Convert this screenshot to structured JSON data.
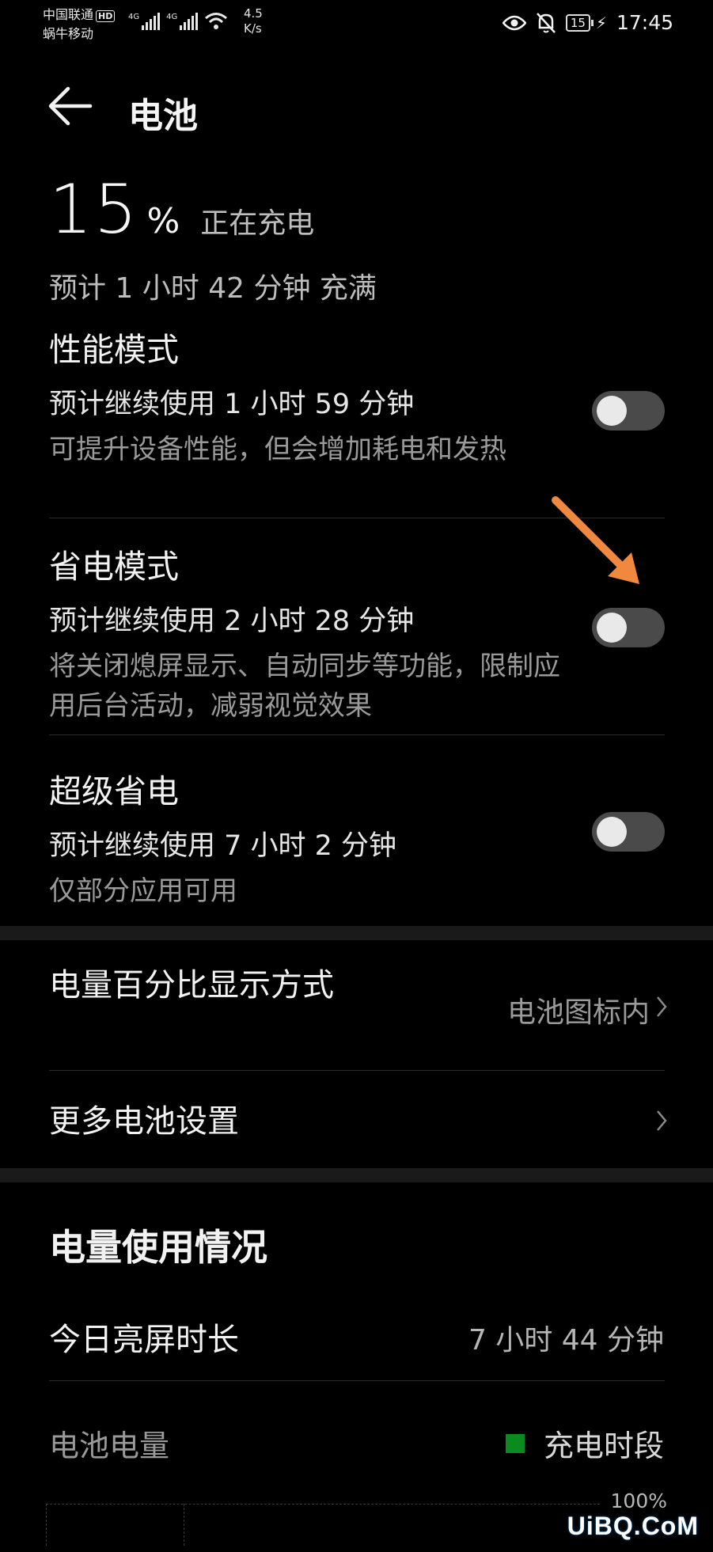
{
  "status_bar": {
    "carrier1": "中国联通",
    "hd_badge": "HD",
    "carrier2": "蜗牛移动",
    "net1": "4G",
    "net2": "4G",
    "speed_value": "4.5",
    "speed_unit": "K/s",
    "battery_level": "15",
    "time": "17:45"
  },
  "header": {
    "title": "电池"
  },
  "battery": {
    "percent": "15",
    "percent_sign": "%",
    "status": "正在充电",
    "full_estimate": "预计 1 小时 42 分钟 充满"
  },
  "modes": [
    {
      "title": "性能模式",
      "estimate": "预计继续使用 1 小时 59 分钟",
      "description": "可提升设备性能，但会增加耗电和发热",
      "enabled": false
    },
    {
      "title": "省电模式",
      "estimate": "预计继续使用 2 小时 28 分钟",
      "description": "将关闭熄屏显示、自动同步等功能，限制应用后台活动，减弱视觉效果",
      "enabled": false
    },
    {
      "title": "超级省电",
      "estimate": "预计继续使用 7 小时 2 分钟",
      "description": "仅部分应用可用",
      "enabled": false
    }
  ],
  "settings": {
    "percent_display": {
      "label": "电量百分比显示方式",
      "value": "电池图标内"
    },
    "more": {
      "label": "更多电池设置"
    }
  },
  "usage": {
    "title": "电量使用情况",
    "screen_time_label": "今日亮屏时长",
    "screen_time_value": "7 小时 44 分钟",
    "battery_level_label": "电池电量",
    "legend_charging": "充电时段",
    "legend_color": "#0a8a1f",
    "axis_max_label": "100%"
  },
  "watermark": "UiBQ.CoM",
  "colors": {
    "background": "#000000",
    "toggle_off": "#4a4a4a",
    "arrow": "#f0883e"
  }
}
